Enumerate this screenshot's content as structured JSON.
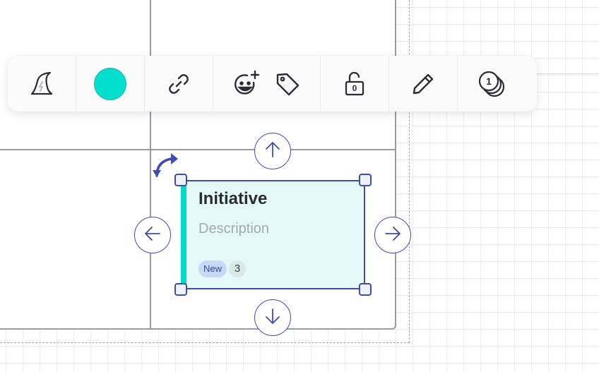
{
  "toolbar": {
    "items": [
      {
        "name": "wizard-hat-icon"
      },
      {
        "name": "color-swatch",
        "color": "#00e0cc"
      },
      {
        "name": "link-icon"
      },
      {
        "name": "add-emoji-icon"
      },
      {
        "name": "tag-icon"
      },
      {
        "name": "unlock-icon",
        "value": "0"
      },
      {
        "name": "pencil-icon"
      },
      {
        "name": "stack-icon",
        "value": "1"
      }
    ]
  },
  "card": {
    "title": "Initiative",
    "description": "Description",
    "badge": "New",
    "count": "3",
    "accent_color": "#00dccb",
    "background_color": "#e4f9f8",
    "selection_color": "#3f4bb5"
  },
  "controls": {
    "arrows": [
      "arrow-up-icon",
      "arrow-down-icon",
      "arrow-left-icon",
      "arrow-right-icon"
    ],
    "rotate": "rotate-icon"
  }
}
